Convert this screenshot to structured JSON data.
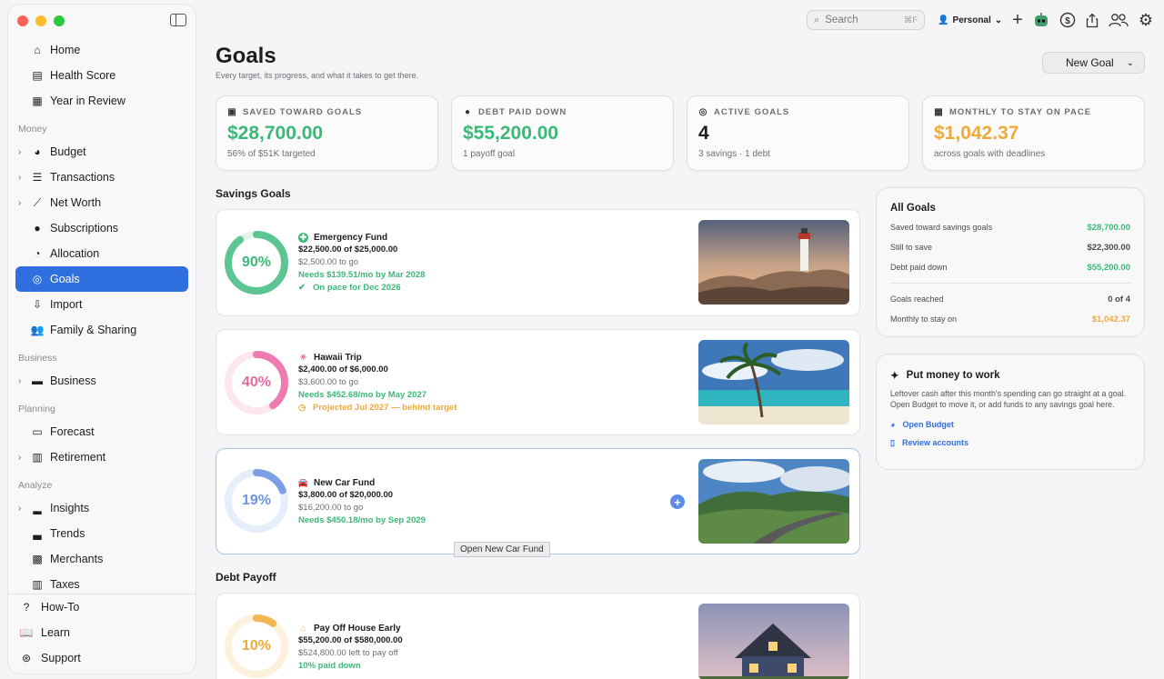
{
  "sidebar": {
    "top_items": [
      {
        "label": "Home",
        "icon": "house-icon"
      },
      {
        "label": "Health Score",
        "icon": "scorecard-icon"
      },
      {
        "label": "Year in Review",
        "icon": "calendar-review-icon"
      }
    ],
    "sections": [
      {
        "title": "Money",
        "items": [
          {
            "label": "Budget",
            "expandable": true
          },
          {
            "label": "Transactions",
            "expandable": true
          },
          {
            "label": "Net Worth",
            "expandable": true
          },
          {
            "label": "Subscriptions",
            "expandable": false
          },
          {
            "label": "Allocation",
            "expandable": false
          },
          {
            "label": "Goals",
            "expandable": false,
            "active": true
          },
          {
            "label": "Import",
            "expandable": false
          },
          {
            "label": "Family & Sharing",
            "expandable": false
          }
        ]
      },
      {
        "title": "Business",
        "items": [
          {
            "label": "Business",
            "expandable": true
          }
        ]
      },
      {
        "title": "Planning",
        "items": [
          {
            "label": "Forecast",
            "expandable": false
          },
          {
            "label": "Retirement",
            "expandable": true
          }
        ]
      },
      {
        "title": "Analyze",
        "items": [
          {
            "label": "Insights",
            "expandable": true
          },
          {
            "label": "Trends",
            "expandable": false
          },
          {
            "label": "Merchants",
            "expandable": false
          },
          {
            "label": "Taxes",
            "expandable": false
          }
        ]
      }
    ],
    "bottom_items": [
      {
        "label": "How-To"
      },
      {
        "label": "Learn"
      },
      {
        "label": "Support"
      }
    ]
  },
  "toolbar": {
    "search_placeholder": "Search",
    "search_shortcut": "⌘F",
    "profile_label": "Personal"
  },
  "page": {
    "title": "Goals",
    "subtitle": "Every target, its progress, and what it takes to get there.",
    "new_goal_label": "New Goal"
  },
  "stats": [
    {
      "label": "SAVED TOWARD GOALS",
      "value": "$28,700.00",
      "sub": "56% of $51K targeted",
      "color": "#3cb878"
    },
    {
      "label": "DEBT PAID DOWN",
      "value": "$55,200.00",
      "sub": "1 payoff goal",
      "color": "#3cb878"
    },
    {
      "label": "ACTIVE GOALS",
      "value": "4",
      "sub": "3 savings · 1 debt",
      "color": "#1d1d1f"
    },
    {
      "label": "MONTHLY TO STAY ON PACE",
      "value": "$1,042.37",
      "sub": "across goals with deadlines",
      "color": "#efaa3c"
    }
  ],
  "savings_title": "Savings Goals",
  "debt_title": "Debt Payoff",
  "goals": [
    {
      "name": "Emergency Fund",
      "pct": 90,
      "pct_label": "90%",
      "amount": "$22,500.00 of $25,000.00",
      "remaining": "$2,500.00 to go",
      "needs": "Needs $139.51/mo by Mar 2028",
      "status": "On pace for Dec 2026",
      "status_kind": "green",
      "ring_color": "#5cc592",
      "track_color": "#e4f5ec",
      "pct_color": "#3cb878"
    },
    {
      "name": "Hawaii Trip",
      "pct": 40,
      "pct_label": "40%",
      "amount": "$2,400.00 of $6,000.00",
      "remaining": "$3,600.00 to go",
      "needs": "Needs $452.68/mo by May 2027",
      "status": "Projected Jul 2027 — behind target",
      "status_kind": "orange",
      "ring_color": "#ee7bb0",
      "track_color": "#fce6f0",
      "pct_color": "#e86aa3"
    },
    {
      "name": "New Car Fund",
      "pct": 19,
      "pct_label": "19%",
      "amount": "$3,800.00 of $20,000.00",
      "remaining": "$16,200.00 to go",
      "needs": "Needs $450.18/mo by Sep 2029",
      "status": "",
      "status_kind": "none",
      "ring_color": "#7b9fe6",
      "track_color": "#e7eefb",
      "pct_color": "#6f93de"
    }
  ],
  "tooltip": "Open New Car Fund",
  "debt": {
    "name": "Pay Off House Early",
    "pct": 10,
    "pct_label": "10%",
    "amount": "$55,200.00 of $580,000.00",
    "remaining": "$524,800.00 left to pay off",
    "status": "10% paid down",
    "ring_color": "#f4b755",
    "track_color": "#fdf0dc",
    "pct_color": "#efaa3c"
  },
  "all_goals": {
    "title": "All Goals",
    "rows": [
      {
        "label": "Saved toward savings goals",
        "value": "$28,700.00",
        "kind": "green"
      },
      {
        "label": "Still to save",
        "value": "$22,300.00",
        "kind": "plain"
      },
      {
        "label": "Debt paid down",
        "value": "$55,200.00",
        "kind": "green"
      }
    ],
    "rows2": [
      {
        "label": "Goals reached",
        "value": "0 of 4",
        "kind": "plain"
      },
      {
        "label": "Monthly to stay on",
        "value": "$1,042.37",
        "kind": "orange"
      }
    ]
  },
  "put_money": {
    "title": "Put money to work",
    "body": "Leftover cash after this month's spending can go straight at a goal. Open Budget to move it, or add funds to any savings goal here.",
    "link1": "Open Budget",
    "link2": "Review accounts"
  },
  "colors": {
    "accent": "#2f6fe0",
    "green": "#3cb878",
    "orange": "#efaa3c"
  }
}
